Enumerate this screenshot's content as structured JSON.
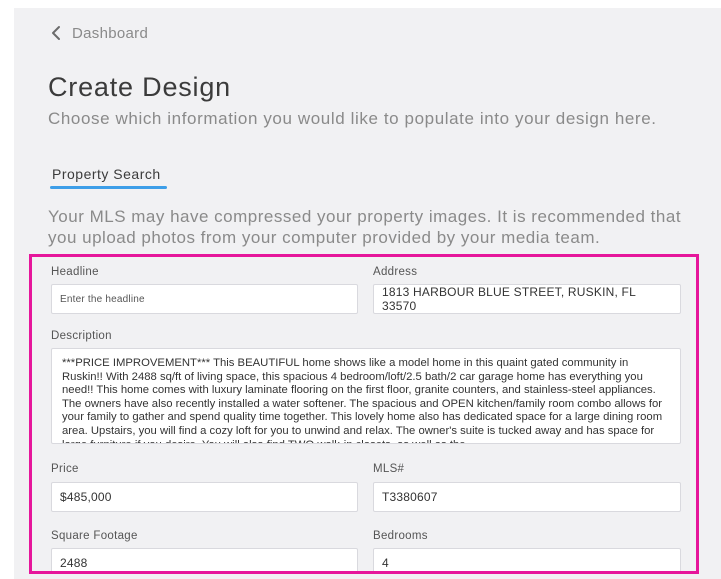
{
  "nav": {
    "back_label": "Dashboard"
  },
  "header": {
    "title": "Create Design",
    "subtitle": "Choose which information you would like to populate into your design here."
  },
  "tabs": [
    {
      "label": "Property Search",
      "active": true
    }
  ],
  "notice": "Your MLS may have compressed your property images. It is recommended that you upload photos from your computer provided by your media team.",
  "form": {
    "headline": {
      "label": "Headline",
      "placeholder": "Enter the headline",
      "value": ""
    },
    "address": {
      "label": "Address",
      "value": "1813 HARBOUR BLUE STREET, RUSKIN, FL 33570"
    },
    "description": {
      "label": "Description",
      "value": "***PRICE IMPROVEMENT*** This BEAUTIFUL home shows like a model home in this quaint gated community in Ruskin!! With 2488 sq/ft of living space, this spacious 4 bedroom/loft/2.5 bath/2 car garage home has everything you need!! This home comes with luxury laminate flooring on the first floor, granite counters, and stainless-steel appliances. The owners have also recently installed a water softener. The spacious and OPEN kitchen/family room combo allows for your family to gather and spend quality time together. This lovely home also has dedicated space for a large dining room area. Upstairs, you will find a cozy loft for you to unwind and relax. The owner's suite is tucked away and has space for large furniture if you desire. You will also find TWO walk-in closets, as well as the"
    },
    "price": {
      "label": "Price",
      "value": "$485,000"
    },
    "mls": {
      "label": "MLS#",
      "value": "T3380607"
    },
    "square_footage": {
      "label": "Square Footage",
      "value": "2488"
    },
    "bedrooms": {
      "label": "Bedrooms",
      "value": "4"
    }
  },
  "colors": {
    "accent": "#3d9ee8",
    "highlight_frame": "#e6169b",
    "page_bg": "#f1f1f3"
  },
  "icons": {
    "back": "chevron-left-icon"
  }
}
